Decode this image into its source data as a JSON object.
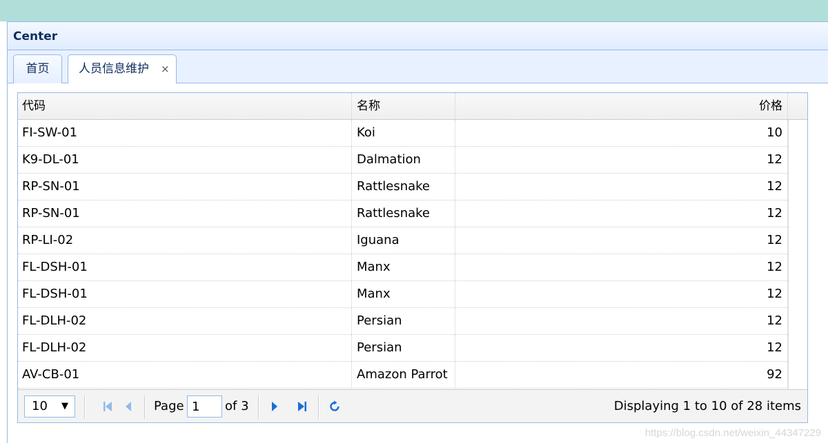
{
  "panel": {
    "title": "Center"
  },
  "tabs": [
    {
      "label": "首页",
      "active": false,
      "closable": false
    },
    {
      "label": "人员信息维护",
      "active": true,
      "closable": true,
      "close_glyph": "×"
    }
  ],
  "grid": {
    "columns": [
      "代码",
      "名称",
      "价格"
    ],
    "rows": [
      {
        "code": "FI-SW-01",
        "name": "Koi",
        "price": "10"
      },
      {
        "code": "K9-DL-01",
        "name": "Dalmation",
        "price": "12"
      },
      {
        "code": "RP-SN-01",
        "name": "Rattlesnake",
        "price": "12"
      },
      {
        "code": "RP-SN-01",
        "name": "Rattlesnake",
        "price": "12"
      },
      {
        "code": "RP-LI-02",
        "name": "Iguana",
        "price": "12"
      },
      {
        "code": "FL-DSH-01",
        "name": "Manx",
        "price": "12"
      },
      {
        "code": "FL-DSH-01",
        "name": "Manx",
        "price": "12"
      },
      {
        "code": "FL-DLH-02",
        "name": "Persian",
        "price": "12"
      },
      {
        "code": "FL-DLH-02",
        "name": "Persian",
        "price": "12"
      },
      {
        "code": "AV-CB-01",
        "name": "Amazon Parrot",
        "price": "92"
      }
    ]
  },
  "pager": {
    "page_size": "10",
    "page_label": "Page",
    "current_page": "1",
    "of_label": "of 3",
    "display_info": "Displaying 1 to 10 of 28 items",
    "icons": {
      "first": "first-page-icon",
      "prev": "prev-page-icon",
      "next": "next-page-icon",
      "last": "last-page-icon",
      "refresh": "refresh-icon"
    }
  },
  "watermark": "https://blog.csdn.net/weixin_44347229",
  "colors": {
    "top_band": "#b0dfd9",
    "border": "#95b8e7",
    "icon_enabled": "#1a6ed8",
    "icon_disabled": "#8fbbe8"
  }
}
